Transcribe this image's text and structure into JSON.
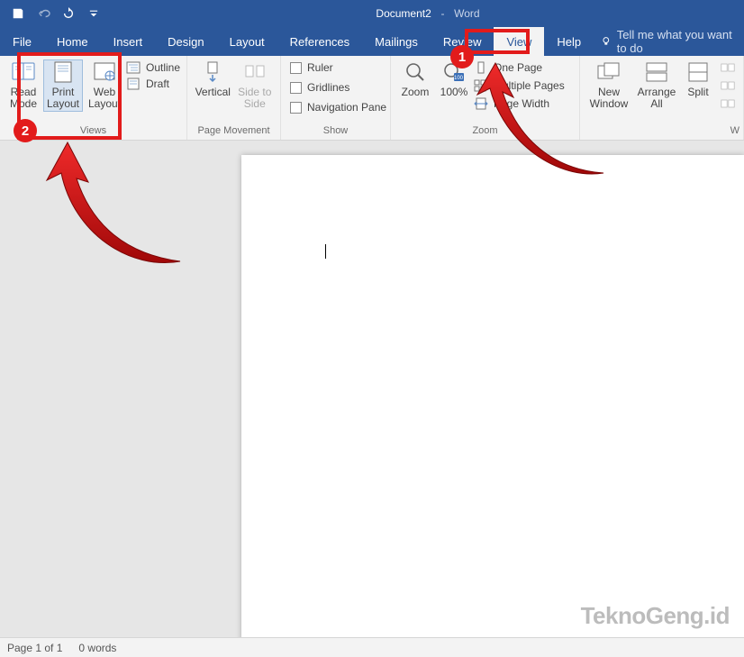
{
  "title": {
    "doc": "Document2",
    "sep": "-",
    "app": "Word"
  },
  "tabs": {
    "file": "File",
    "home": "Home",
    "insert": "Insert",
    "design": "Design",
    "layout": "Layout",
    "references": "References",
    "mailings": "Mailings",
    "review": "Review",
    "view": "View",
    "help": "Help"
  },
  "tellme": "Tell me what you want to do",
  "ribbon": {
    "views": {
      "label": "Views",
      "read": "Read Mode",
      "print": "Print Layout",
      "web": "Web Layout",
      "outline": "Outline",
      "draft": "Draft"
    },
    "pagemove": {
      "label": "Page Movement",
      "vertical": "Vertical",
      "side": "Side to Side"
    },
    "show": {
      "label": "Show",
      "ruler": "Ruler",
      "gridlines": "Gridlines",
      "nav": "Navigation Pane"
    },
    "zoom": {
      "label": "Zoom",
      "zoom": "Zoom",
      "hundred": "100%",
      "one": "One Page",
      "multi": "Multiple Pages",
      "pwidth": "Page Width"
    },
    "window": {
      "label": "W",
      "neww": "New Window",
      "arrange": "Arrange All",
      "split": "Split"
    }
  },
  "status": {
    "page": "Page 1 of 1",
    "words": "0 words"
  },
  "annot": {
    "n1": "1",
    "n2": "2"
  },
  "watermark": "TeknoGeng.id"
}
